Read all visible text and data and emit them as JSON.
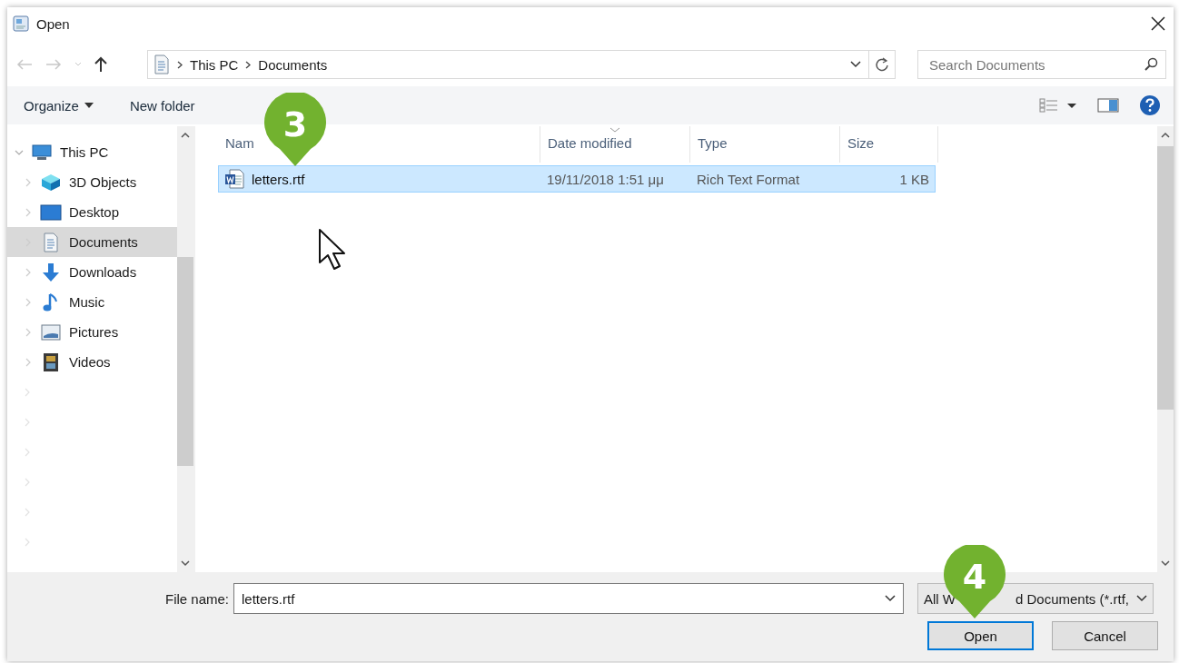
{
  "window": {
    "title": "Open"
  },
  "address": {
    "path": [
      "This PC",
      "Documents"
    ],
    "search_placeholder": "Search Documents"
  },
  "toolbar": {
    "organize": "Organize",
    "new_folder": "New folder"
  },
  "nav": [
    {
      "label": "This PC",
      "kind": "pc",
      "expanded": true,
      "selected": false,
      "children": [
        {
          "label": "3D Objects",
          "kind": "cube",
          "selected": false
        },
        {
          "label": "Desktop",
          "kind": "desktop",
          "selected": false
        },
        {
          "label": "Documents",
          "kind": "documents",
          "selected": true
        },
        {
          "label": "Downloads",
          "kind": "downloads",
          "selected": false
        },
        {
          "label": "Music",
          "kind": "music",
          "selected": false
        },
        {
          "label": "Pictures",
          "kind": "pictures",
          "selected": false
        },
        {
          "label": "Videos",
          "kind": "videos",
          "selected": false
        }
      ]
    }
  ],
  "columns": [
    {
      "label": "Nam",
      "sorted": false
    },
    {
      "label": "Date modified",
      "sorted": true
    },
    {
      "label": "Type",
      "sorted": false
    },
    {
      "label": "Size",
      "sorted": false
    }
  ],
  "files": [
    {
      "name": "letters.rtf",
      "date": "19/11/2018 1:51 μμ",
      "type": "Rich Text Format",
      "size": "1 KB",
      "selected": true
    }
  ],
  "footer": {
    "file_name_label": "File name:",
    "file_name": "letters.rtf",
    "filter": [
      "All W",
      "d Documents (*.rtf,"
    ],
    "buttons": [
      {
        "label": "Open",
        "default": true
      },
      {
        "label": "Cancel",
        "default": false
      }
    ]
  },
  "callouts": [
    {
      "number": "3"
    },
    {
      "number": "4"
    }
  ]
}
